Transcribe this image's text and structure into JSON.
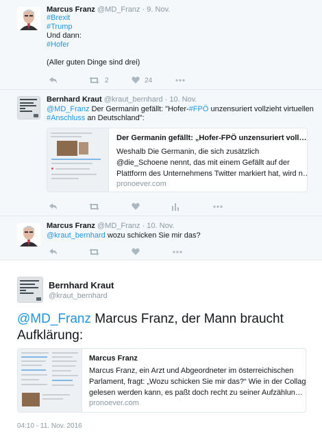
{
  "colors": {
    "link": "#1b95e0",
    "secondary_text": "#8899a6",
    "icon": "#aab8c2",
    "conversation_bg": "#f5f8fa"
  },
  "tweets": [
    {
      "name": "Marcus Franz",
      "handle": "@MD_Franz",
      "date": "9. Nov.",
      "lines": [
        "#Brexit",
        "#Trump",
        "Und dann:",
        "#Hofer",
        "(Aller guten Dinge sind drei)"
      ],
      "retweets": "2",
      "likes": "24",
      "icons": [
        "reply-icon",
        "retweet-icon",
        "heart-icon",
        "more-options-icon"
      ]
    },
    {
      "name": "Bernhard Kraut",
      "handle": "@kraut_bernhard",
      "date": "10. Nov.",
      "mention": "@MD_Franz",
      "seg1": "Der Germanin gefällt: \"Hofer-",
      "tag1": "#FPÖ",
      "seg2": "unzensuriert vollzieht virtuellen",
      "tag2": "#Anschluss",
      "seg3": "an Deutschland\":",
      "card": {
        "title": "Der Germanin gefällt: „Hofer-FPÖ unzensuriert voll…",
        "desc": [
          "Weshalb Die Germanin, die sich zusätzlich",
          "@die_Schoene nennt, das mit einem Gefällt auf der",
          "Plattform des Unternehmens Twitter markiert hat, wird n…"
        ],
        "domain": "pronoever.com"
      },
      "icons": [
        "reply-icon",
        "retweet-icon",
        "heart-icon",
        "analytics-icon",
        "more-options-icon"
      ]
    },
    {
      "name": "Marcus Franz",
      "handle": "@MD_Franz",
      "date": "10. Nov.",
      "mention": "@kraut_bernhard",
      "text": "wozu schicken Sie mir das?",
      "icons": [
        "reply-icon",
        "retweet-icon",
        "heart-icon",
        "more-options-icon"
      ]
    }
  ],
  "focused": {
    "name": "Bernhard Kraut",
    "handle": "@kraut_bernhard",
    "mention": "@MD_Franz",
    "text_line1": "Marcus Franz, der Mann braucht",
    "text_line2": "Aufklärung:",
    "card": {
      "title": "Marcus Franz",
      "desc": [
        "Marcus Franz, ein Arzt und Abgeordneter im österreichischen",
        "Parlament, fragt: „Wozu schicken Sie mir das?“ Wie in der Collage",
        "gelesen werden kann, es paßt doch recht zu seiner Aufzählun…"
      ],
      "domain": "pronoever.com"
    },
    "timestamp": "04:10 - 11. Nov. 2016"
  }
}
